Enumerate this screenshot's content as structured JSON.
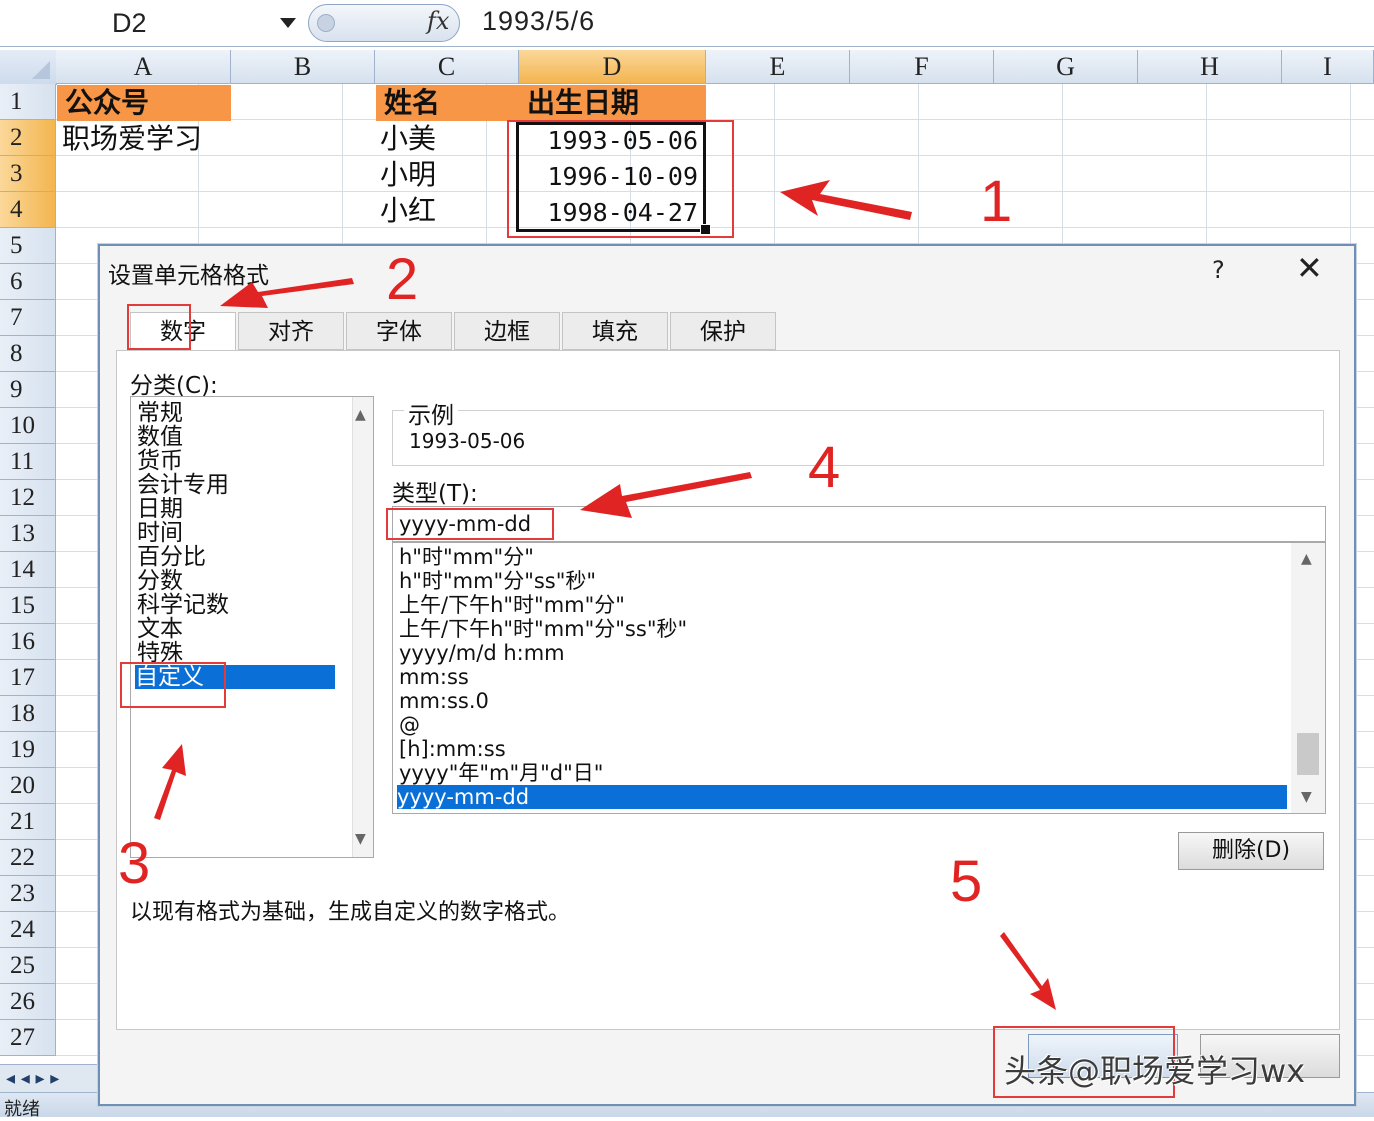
{
  "formula_bar": {
    "name_box": "D2",
    "fx_label": "fx",
    "value": "1993/5/6"
  },
  "sheet": {
    "columns": [
      "A",
      "B",
      "C",
      "D",
      "E",
      "F",
      "G",
      "H",
      "I"
    ],
    "rows": [
      "1",
      "2",
      "3",
      "4",
      "5",
      "6",
      "7",
      "8",
      "9",
      "10",
      "11",
      "12",
      "13",
      "14",
      "15",
      "16",
      "17",
      "18",
      "19",
      "20",
      "21",
      "22",
      "23",
      "24",
      "25",
      "26",
      "27"
    ],
    "cells": {
      "A1": "公众号",
      "A2": "职场爱学习",
      "C1": "姓名",
      "C2": "小美",
      "C3": "小明",
      "C4": "小红",
      "D1": "出生日期",
      "D2": "1993-05-06",
      "D3": "1996-10-09",
      "D4": "1998-04-27"
    },
    "header_color": "#f79646",
    "selected_column_color": "#f3b54f"
  },
  "sheet_nav": {
    "arrows": "◂ ◂ ▸ ▸"
  },
  "status_bar": {
    "text": "就绪"
  },
  "dialog": {
    "title": "设置单元格格式",
    "help": "?",
    "close": "✕",
    "tabs": [
      "数字",
      "对齐",
      "字体",
      "边框",
      "填充",
      "保护"
    ],
    "category_label": "分类(C):",
    "categories": [
      "常规",
      "数值",
      "货币",
      "会计专用",
      "日期",
      "时间",
      "百分比",
      "分数",
      "科学记数",
      "文本",
      "特殊",
      "自定义"
    ],
    "sample_label": "示例",
    "sample_value": "1993-05-06",
    "type_label": "类型(T):",
    "type_value": "yyyy-mm-dd",
    "formats": [
      "h\"时\"mm\"分\"",
      "h\"时\"mm\"分\"ss\"秒\"",
      "上午/下午h\"时\"mm\"分\"",
      "上午/下午h\"时\"mm\"分\"ss\"秒\"",
      "yyyy/m/d h:mm",
      "mm:ss",
      "mm:ss.0",
      "@",
      "[h]:mm:ss",
      "yyyy\"年\"m\"月\"d\"日\"",
      "yyyy-mm-dd"
    ],
    "delete_button": "删除(D)",
    "description": "以现有格式为基础，生成自定义的数字格式。"
  },
  "annotations": {
    "numbers": [
      "1",
      "2",
      "3",
      "4",
      "5"
    ],
    "color": "#e02424",
    "watermark": "头条@职场爱学习wx"
  }
}
